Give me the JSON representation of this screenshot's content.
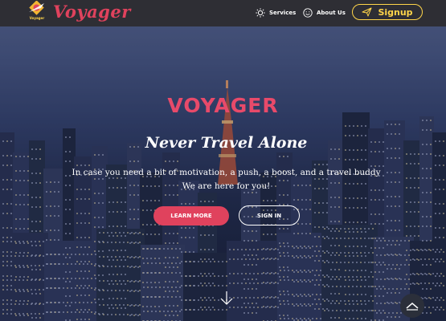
{
  "brand": {
    "logo_caption": "Voyager",
    "name": "Voyager",
    "logo_icon": "globe-plane-icon"
  },
  "nav": {
    "items": [
      {
        "label": "Services",
        "icon": "sun-icon"
      },
      {
        "label": "About Us",
        "icon": "smiley-icon"
      }
    ],
    "signup_label": "Signup",
    "signup_icon": "paper-plane-icon"
  },
  "hero": {
    "brand": "VOYAGER",
    "title": "Never Travel Alone",
    "subtitle_line1": "In case you need a bit of motivation, a push, a boost, and a travel buddy",
    "subtitle_line2": "We are here for you!",
    "learn_more_label": "LEARN MORE",
    "sign_in_label": "SIGN IN",
    "scroll_icon": "arrow-down-icon",
    "back_to_top_icon": "chevron-up-icon"
  },
  "colors": {
    "accent": "#e0425d",
    "signup": "#ffd54a",
    "navbar": "#2e2e34"
  }
}
